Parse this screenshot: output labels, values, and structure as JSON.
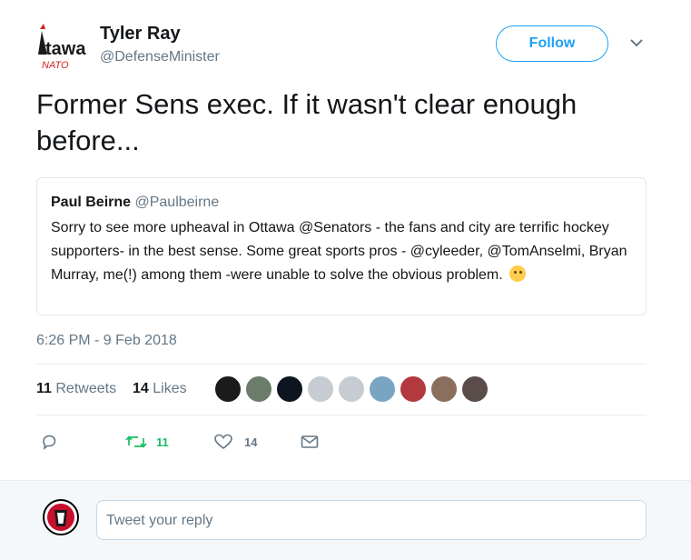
{
  "author": {
    "name": "Tyler Ray",
    "handle": "@DefenseMinister",
    "avatar_text": "Ottawa"
  },
  "follow_label": "Follow",
  "tweet_text": "Former Sens exec. If it wasn't clear enough before...",
  "quoted": {
    "name": "Paul Beirne",
    "handle": "@Paulbeirne",
    "text": "Sorry to see more upheaval in Ottawa @Senators - the fans and city are terrific hockey supporters- in the best sense.  Some great sports pros - @cyleeder, @TomAnselmi, Bryan Murray, me(!) among them -were unable to solve the obvious problem.",
    "emoji": "thinking-face"
  },
  "timestamp": "6:26 PM - 9 Feb 2018",
  "stats": {
    "retweets_count": "11",
    "retweets_label": "Retweets",
    "likes_count": "14",
    "likes_label": "Likes"
  },
  "likers": [
    {
      "color": "#1b1b1b"
    },
    {
      "color": "#6b7c6a"
    },
    {
      "color": "#0d1521"
    },
    {
      "color": "#c6ccd2"
    },
    {
      "color": "#c6ccd2"
    },
    {
      "color": "#7aa5c2"
    },
    {
      "color": "#b23a3e"
    },
    {
      "color": "#8a6f5e"
    },
    {
      "color": "#5a4c4a"
    }
  ],
  "actions": {
    "reply_count": "",
    "retweet_count": "11",
    "like_count": "14"
  },
  "reply": {
    "placeholder": "Tweet your reply"
  },
  "colors": {
    "accent": "#1da1f2",
    "retweet_green": "#17bf63",
    "muted": "#657786"
  }
}
